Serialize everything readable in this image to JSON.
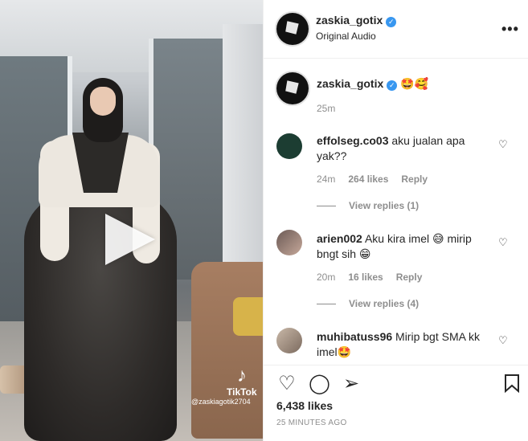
{
  "media": {
    "play_icon": "play-icon",
    "tiktok_icon": "tiktok-icon",
    "tiktok_label": "TikTok",
    "tiktok_user": "@zaskiagotik2704"
  },
  "header": {
    "username": "zaskia_gotix",
    "subtitle": "Original Audio",
    "more_icon": "more-icon"
  },
  "caption": {
    "username": "zaskia_gotix",
    "text": "🤩🥰",
    "time": "25m"
  },
  "comments": [
    {
      "username": "effolseg.co03",
      "text": "aku jualan apa \nyak??",
      "time": "24m",
      "likes": "264 likes",
      "reply": "Reply",
      "view_replies": "View replies (1)"
    },
    {
      "username": "arien002",
      "text": "Aku kira imel 😅 mirip bngt sih 😁",
      "time": "20m",
      "likes": "16 likes",
      "reply": "Reply",
      "view_replies": "View replies (4)"
    },
    {
      "username": "muhibatuss96",
      "text": "Mirip bgt SMA kk imel🤩"
    }
  ],
  "actions": {
    "like_icon": "heart-icon",
    "comment_icon": "comment-icon",
    "share_icon": "share-icon",
    "save_icon": "bookmark-icon",
    "likes": "6,438 likes",
    "time_ago": "25 MINUTES AGO"
  }
}
